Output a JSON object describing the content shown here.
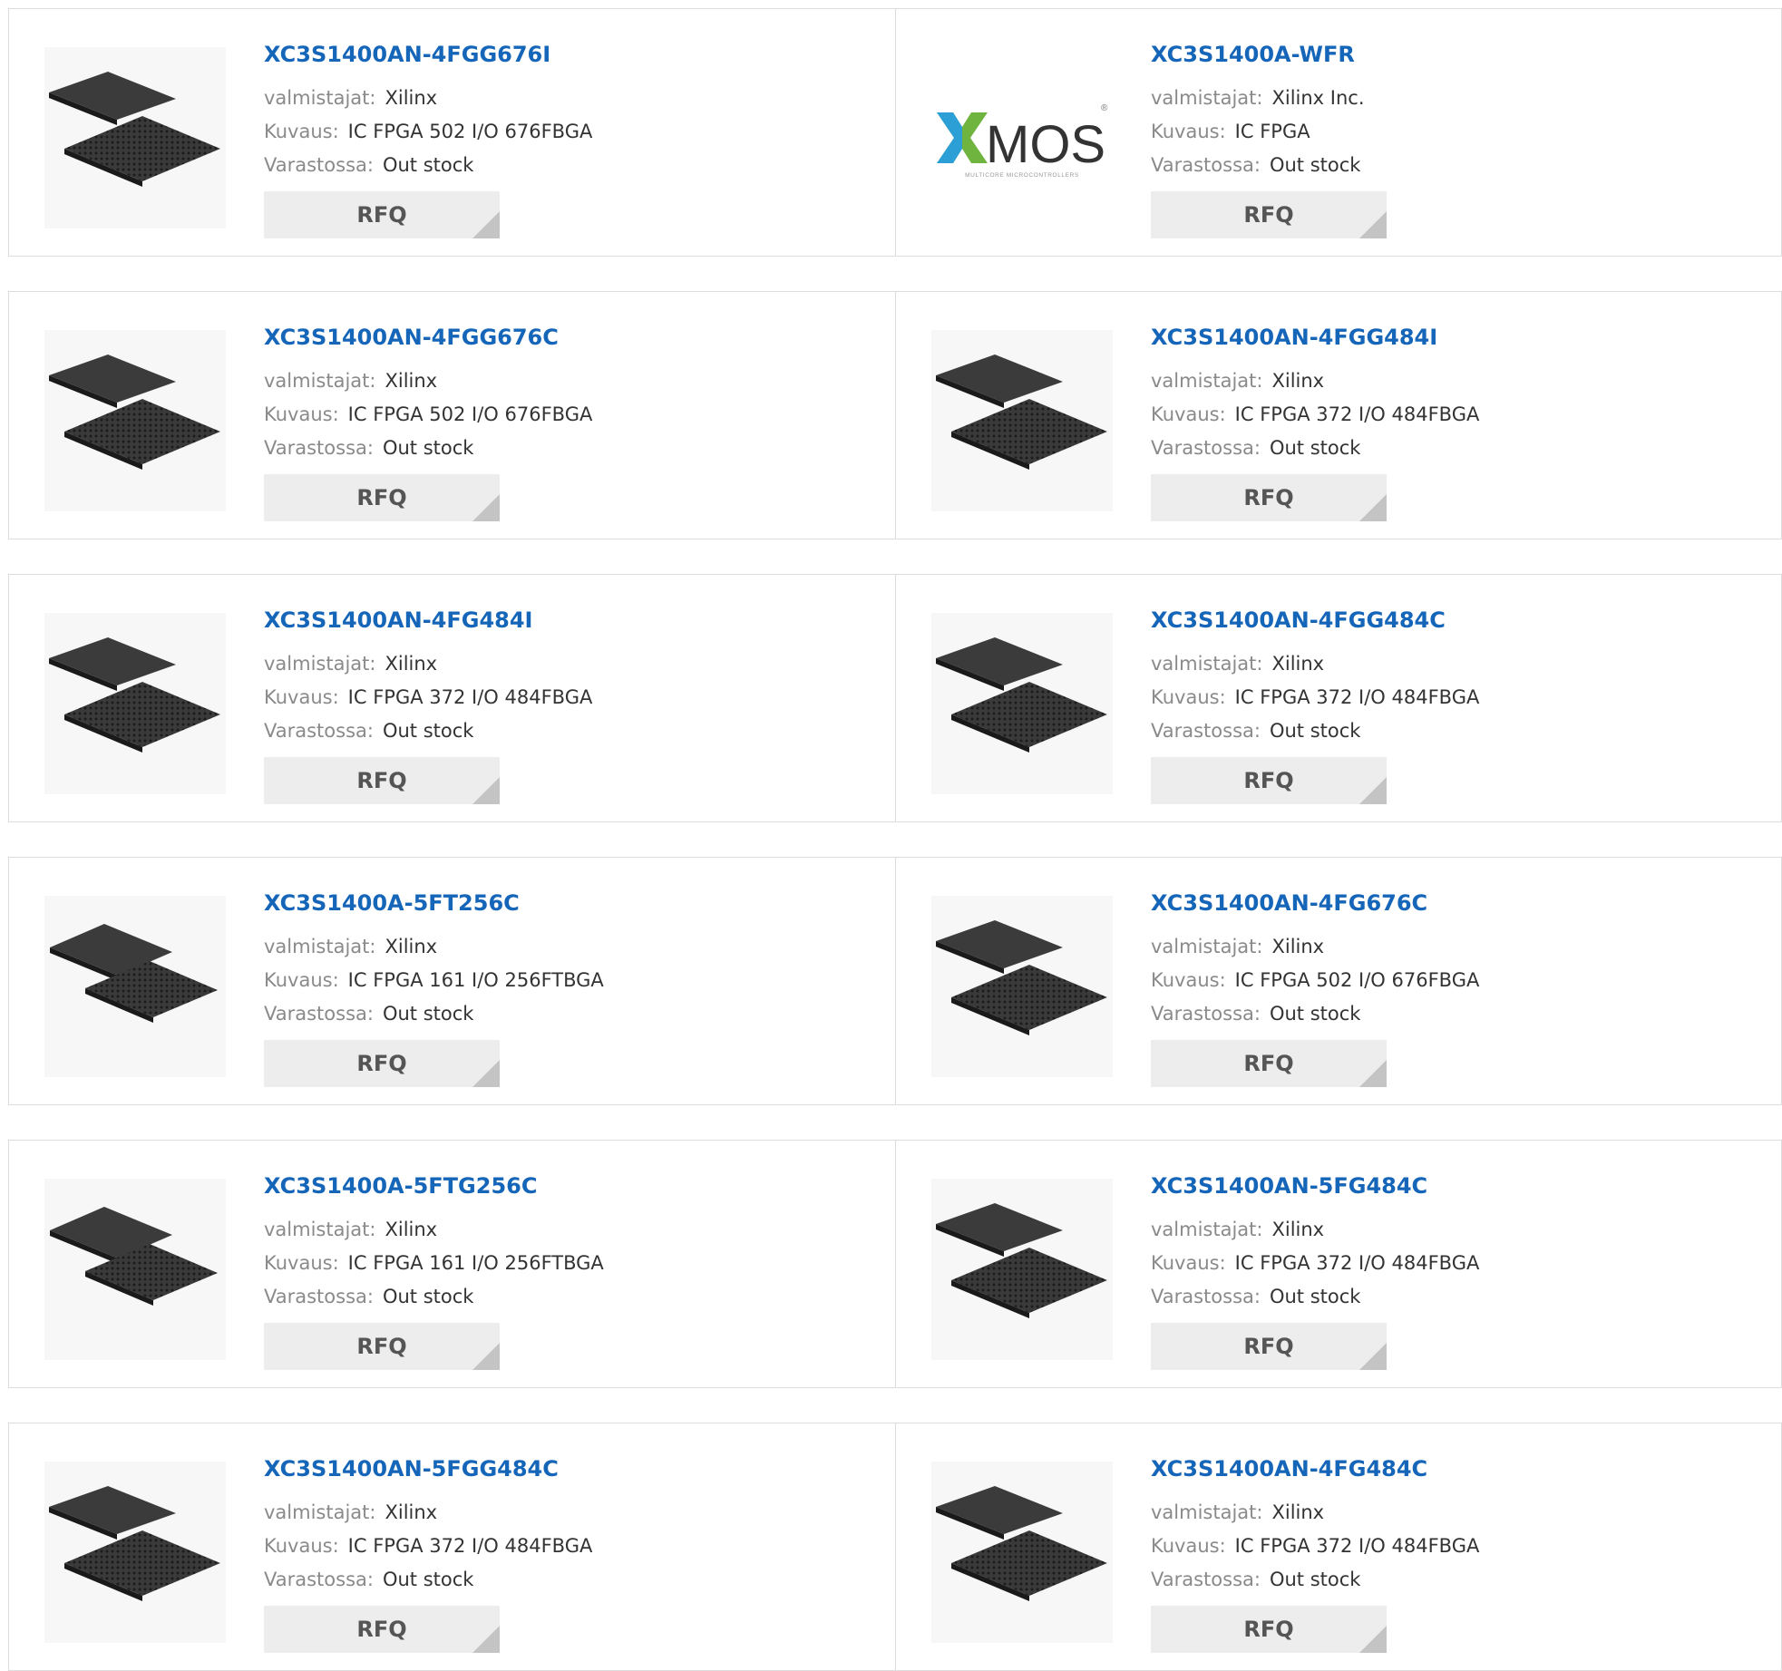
{
  "labels": {
    "manufacturer": "valmistajat:",
    "description": "Kuvaus:",
    "stock": "Varastossa:"
  },
  "colors": {
    "link": "#1565b9",
    "label": "#8a8a8a",
    "value": "#333333",
    "button_bg": "#ededed",
    "border": "#dcdcdc"
  },
  "products": [
    {
      "part": "XC3S1400AN-4FGG676I",
      "manufacturer": "Xilinx",
      "description": "IC FPGA 502 I/O 676FBGA",
      "stock": "Out stock",
      "button": "RFQ",
      "image": "bga-chip-icon",
      "image_variant": "a"
    },
    {
      "part": "XC3S1400A-WFR",
      "manufacturer": "Xilinx Inc.",
      "description": "IC FPGA",
      "stock": "Out stock",
      "button": "RFQ",
      "image": "xmos-logo",
      "logo_text": "XMOS",
      "logo_subtext": "MULTICORE MICROCONTROLLERS",
      "logo_mark": "®"
    },
    {
      "part": "XC3S1400AN-4FGG676C",
      "manufacturer": "Xilinx",
      "description": "IC FPGA 502 I/O 676FBGA",
      "stock": "Out stock",
      "button": "RFQ",
      "image": "bga-chip-icon",
      "image_variant": "a"
    },
    {
      "part": "XC3S1400AN-4FGG484I",
      "manufacturer": "Xilinx",
      "description": "IC FPGA 372 I/O 484FBGA",
      "stock": "Out stock",
      "button": "RFQ",
      "image": "bga-chip-icon",
      "image_variant": "a"
    },
    {
      "part": "XC3S1400AN-4FG484I",
      "manufacturer": "Xilinx",
      "description": "IC FPGA 372 I/O 484FBGA",
      "stock": "Out stock",
      "button": "RFQ",
      "image": "bga-chip-icon",
      "image_variant": "a"
    },
    {
      "part": "XC3S1400AN-4FGG484C",
      "manufacturer": "Xilinx",
      "description": "IC FPGA 372 I/O 484FBGA",
      "stock": "Out stock",
      "button": "RFQ",
      "image": "bga-chip-icon",
      "image_variant": "a"
    },
    {
      "part": "XC3S1400A-5FT256C",
      "manufacturer": "Xilinx",
      "description": "IC FPGA 161 I/O 256FTBGA",
      "stock": "Out stock",
      "button": "RFQ",
      "image": "bga-chip-icon",
      "image_variant": "b"
    },
    {
      "part": "XC3S1400AN-4FG676C",
      "manufacturer": "Xilinx",
      "description": "IC FPGA 502 I/O 676FBGA",
      "stock": "Out stock",
      "button": "RFQ",
      "image": "bga-chip-icon",
      "image_variant": "a"
    },
    {
      "part": "XC3S1400A-5FTG256C",
      "manufacturer": "Xilinx",
      "description": "IC FPGA 161 I/O 256FTBGA",
      "stock": "Out stock",
      "button": "RFQ",
      "image": "bga-chip-icon",
      "image_variant": "b"
    },
    {
      "part": "XC3S1400AN-5FG484C",
      "manufacturer": "Xilinx",
      "description": "IC FPGA 372 I/O 484FBGA",
      "stock": "Out stock",
      "button": "RFQ",
      "image": "bga-chip-icon",
      "image_variant": "a"
    },
    {
      "part": "XC3S1400AN-5FGG484C",
      "manufacturer": "Xilinx",
      "description": "IC FPGA 372 I/O 484FBGA",
      "stock": "Out stock",
      "button": "RFQ",
      "image": "bga-chip-icon",
      "image_variant": "a"
    },
    {
      "part": "XC3S1400AN-4FG484C",
      "manufacturer": "Xilinx",
      "description": "IC FPGA 372 I/O 484FBGA",
      "stock": "Out stock",
      "button": "RFQ",
      "image": "bga-chip-icon",
      "image_variant": "a"
    }
  ]
}
